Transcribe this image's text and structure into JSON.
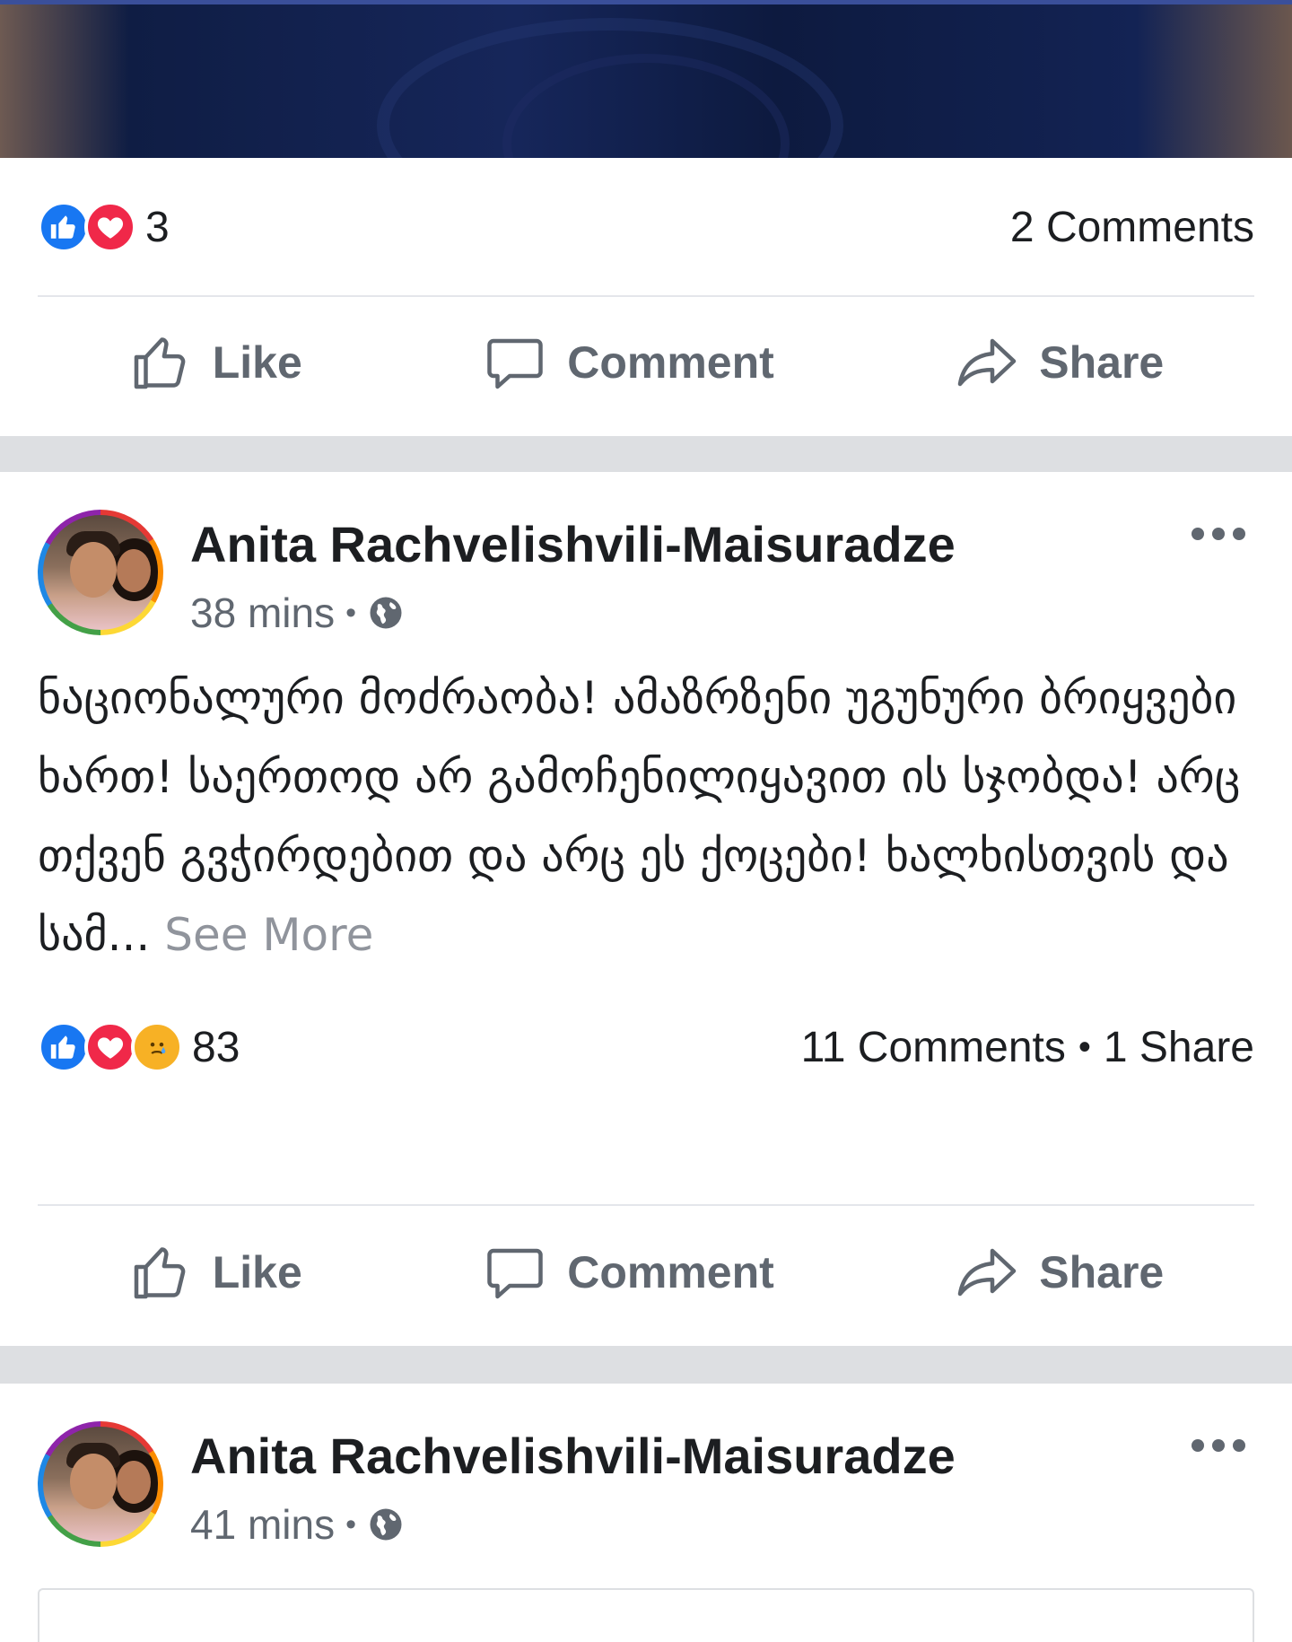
{
  "posts": [
    {
      "reactions": [
        "like",
        "love"
      ],
      "reaction_count": "3",
      "comments": "2 Comments",
      "shares": "",
      "actions": {
        "like": "Like",
        "comment": "Comment",
        "share": "Share"
      }
    },
    {
      "author": "Anita Rachvelishvili-Maisuradze",
      "time": "38 mins",
      "separator": "•",
      "text": "ნაციონალური მოძრაობა! ამაზრზენი უგუნური ბრიყვები ხართ! საერთოდ არ გამოჩენილიყავით ის სჯობდა! არც თქვენ გვჭირდებით და არც ეს ქოცები! ხალხისთვის და სამ...",
      "see_more": "See More",
      "reactions": [
        "like",
        "love",
        "sad"
      ],
      "reaction_count": "83",
      "comments": "11 Comments",
      "stats_separator": "•",
      "shares": "1 Share",
      "actions": {
        "like": "Like",
        "comment": "Comment",
        "share": "Share"
      }
    },
    {
      "author": "Anita Rachvelishvili-Maisuradze",
      "time": "41 mins",
      "separator": "•"
    }
  ],
  "icons": {
    "like": "thumbs-up-icon",
    "love": "heart-icon",
    "sad": "crying-face-icon",
    "comment": "speech-bubble-icon",
    "share": "share-arrow-icon",
    "privacy": "globe-icon",
    "more": "more-options-icon"
  },
  "colors": {
    "like_blue": "#1877f2",
    "love_red": "#f02849",
    "sad_yellow": "#f7b125",
    "action_gray": "#606770",
    "separator_gray": "#dddfe2"
  }
}
